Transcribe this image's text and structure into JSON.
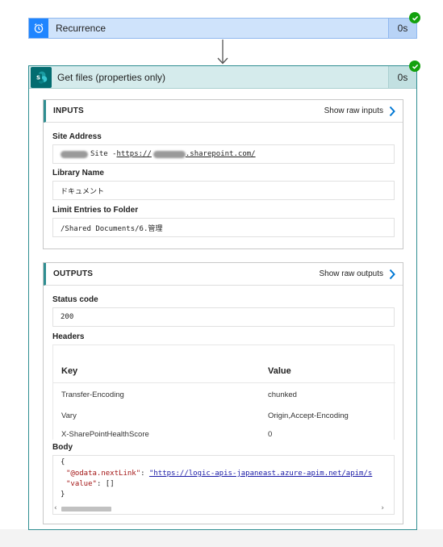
{
  "trigger": {
    "title": "Recurrence",
    "duration": "0s",
    "icon": "alarm-clock-icon",
    "status": "succeeded"
  },
  "action": {
    "title": "Get files (properties only)",
    "duration": "0s",
    "icon": "sharepoint-icon",
    "status": "succeeded",
    "inputs": {
      "title": "INPUTS",
      "raw_label": "Show raw inputs",
      "site_address_label": "Site Address",
      "site_address_prefix": "Site - ",
      "site_address_url_start": "https://",
      "site_address_url_end": ".sharepoint.com/",
      "library_name_label": "Library Name",
      "library_name_value": "ドキュメント",
      "limit_folder_label": "Limit Entries to Folder",
      "limit_folder_value": "/Shared Documents/6.管理"
    },
    "outputs": {
      "title": "OUTPUTS",
      "raw_label": "Show raw outputs",
      "status_code_label": "Status code",
      "status_code_value": "200",
      "headers_label": "Headers",
      "headers_key_col": "Key",
      "headers_value_col": "Value",
      "headers": [
        {
          "key": "Transfer-Encoding",
          "value": "chunked"
        },
        {
          "key": "Vary",
          "value": "Origin,Accept-Encoding"
        },
        {
          "key": "X-SharePointHealthScore",
          "value": "0"
        }
      ],
      "body_label": "Body",
      "body_open": "{",
      "body_key1": "\"@odata.nextLink\"",
      "body_sep1": ": ",
      "body_val1": "\"https://logic-apis-japaneast.azure-apim.net/apim/s",
      "body_key2": "\"value\"",
      "body_val2": ": []",
      "body_close": "}"
    }
  },
  "colors": {
    "trigger_accent": "#1f85ff",
    "action_accent": "#036c70",
    "success": "#13a10e",
    "link": "#0078d4"
  }
}
